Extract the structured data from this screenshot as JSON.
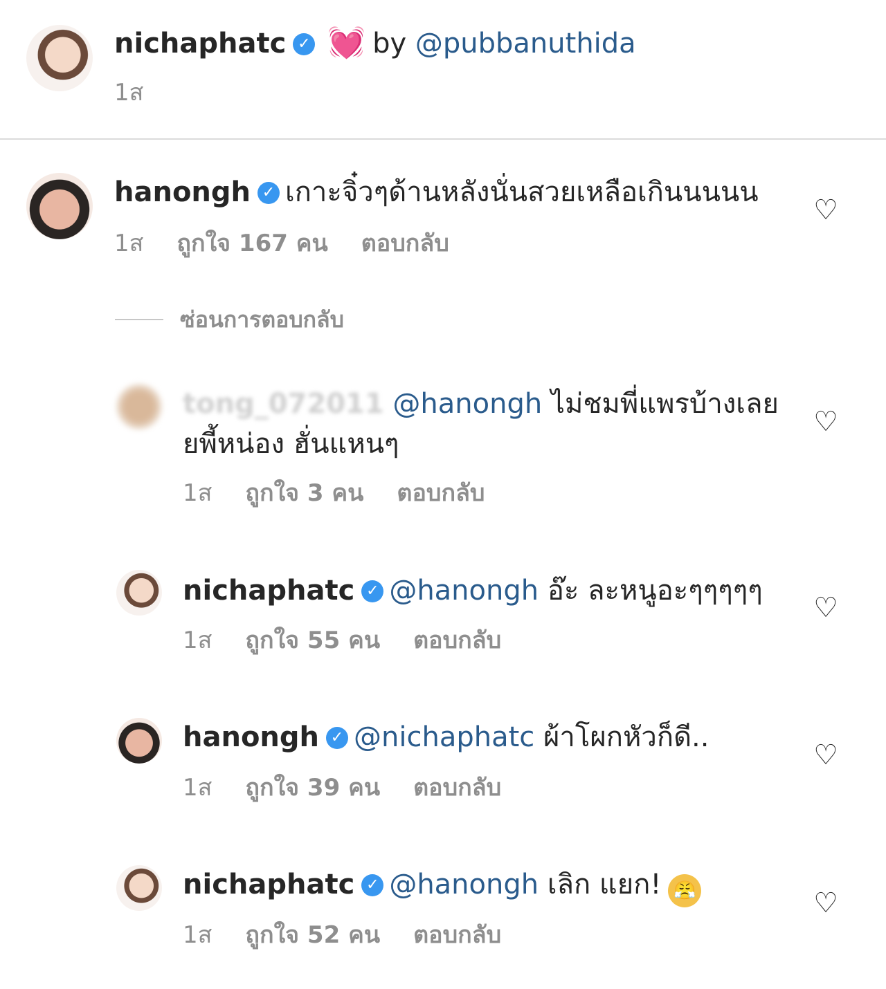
{
  "caption": {
    "username": "nichaphatc",
    "heart_emoji": "💓",
    "by_text": "by",
    "mention": "@pubbanuthida",
    "time": "1ส"
  },
  "comments": [
    {
      "username": "hanongh",
      "text": "เกาะจิ๋วๆด้านหลังนั่นสวยเหลือเกินนนนน",
      "time": "1ส",
      "likes": "ถูกใจ 167 คน",
      "reply": "ตอบกลับ"
    }
  ],
  "hide_replies": "ซ่อนการตอบกลับ",
  "replies": [
    {
      "username": "tong_072011",
      "mention": "@hanongh",
      "text": "ไม่ชมพี่แพรบ้างเลย",
      "text2": "ยพี้หน่อง ฮั่นแหนๆ",
      "time": "1ส",
      "likes": "ถูกใจ 3 คน",
      "reply": "ตอบกลับ"
    },
    {
      "username": "nichaphatc",
      "mention": "@hanongh",
      "text": "อ๊ะ ละหนูอะๆๆๆๆๆ",
      "time": "1ส",
      "likes": "ถูกใจ 55 คน",
      "reply": "ตอบกลับ"
    },
    {
      "username": "hanongh",
      "mention": "@nichaphatc",
      "text": "ผ้าโผกหัวก็ดี..",
      "time": "1ส",
      "likes": "ถูกใจ 39 คน",
      "reply": "ตอบกลับ"
    },
    {
      "username": "nichaphatc",
      "mention": "@hanongh",
      "text": "เลิก แยก!",
      "time": "1ส",
      "likes": "ถูกใจ 52 คน",
      "reply": "ตอบกลับ"
    }
  ],
  "icons": {
    "verified": "verified-badge-icon",
    "like": "heart-outline-icon",
    "emoji": "steam-face-emoji"
  },
  "colors": {
    "mention": "#2a5b8c",
    "verified": "#3897f0",
    "meta": "#8e8e8e"
  }
}
